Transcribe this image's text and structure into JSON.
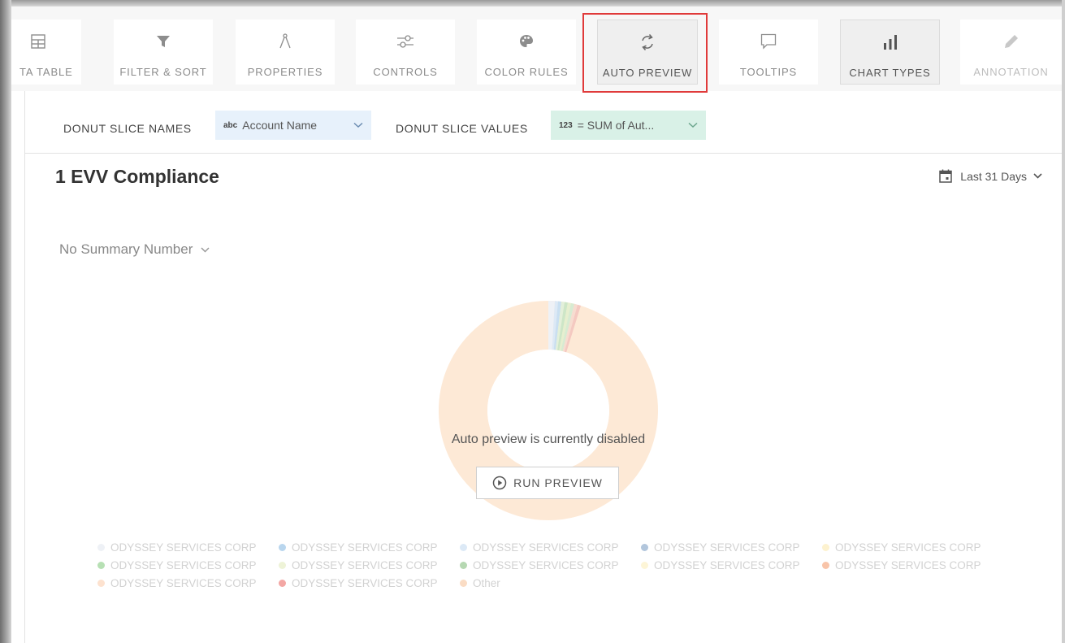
{
  "toolbar": {
    "items": [
      {
        "label": "TA TABLE",
        "icon": "table-icon"
      },
      {
        "label": "FILTER & SORT",
        "icon": "filter-icon"
      },
      {
        "label": "PROPERTIES",
        "icon": "compass-icon"
      },
      {
        "label": "CONTROLS",
        "icon": "sliders-icon"
      },
      {
        "label": "COLOR RULES",
        "icon": "palette-icon"
      },
      {
        "label": "AUTO PREVIEW",
        "icon": "refresh-icon"
      },
      {
        "label": "TOOLTIPS",
        "icon": "speech-bubble-icon"
      },
      {
        "label": "CHART TYPES",
        "icon": "bar-chart-icon"
      },
      {
        "label": "ANNOTATION",
        "icon": "pencil-icon"
      }
    ]
  },
  "settings": {
    "slice_names_label": "DONUT SLICE NAMES",
    "slice_names_type": "abc",
    "slice_names_value": "Account Name",
    "slice_values_label": "DONUT SLICE VALUES",
    "slice_values_type": "123",
    "slice_values_value": "= SUM of Aut..."
  },
  "chart": {
    "title": "1 EVV Compliance",
    "date_range": "Last 31 Days",
    "summary": "No Summary Number",
    "disabled_message": "Auto preview is currently disabled",
    "run_button": "RUN PREVIEW"
  },
  "colors": {
    "donut_main": "#fde9d6",
    "highlight": "#e03a3a"
  },
  "legend": [
    {
      "label": "ODYSSEY SERVICES CORP",
      "color": "#eef1f6"
    },
    {
      "label": "ODYSSEY SERVICES CORP",
      "color": "#b9d6ee"
    },
    {
      "label": "ODYSSEY SERVICES CORP",
      "color": "#dce9f6"
    },
    {
      "label": "ODYSSEY SERVICES CORP",
      "color": "#b2c6dc"
    },
    {
      "label": "ODYSSEY SERVICES CORP",
      "color": "#fdf2cf"
    },
    {
      "label": "ODYSSEY SERVICES CORP",
      "color": "#b7e0b4"
    },
    {
      "label": "ODYSSEY SERVICES CORP",
      "color": "#eef3d7"
    },
    {
      "label": "ODYSSEY SERVICES CORP",
      "color": "#b6d8b2"
    },
    {
      "label": "ODYSSEY SERVICES CORP",
      "color": "#fdf5d7"
    },
    {
      "label": "ODYSSEY SERVICES CORP",
      "color": "#f8c4a9"
    },
    {
      "label": "ODYSSEY SERVICES CORP",
      "color": "#fde2cf"
    },
    {
      "label": "ODYSSEY SERVICES CORP",
      "color": "#f3a7a4"
    },
    {
      "label": "Other",
      "color": "#fadcc4"
    }
  ]
}
